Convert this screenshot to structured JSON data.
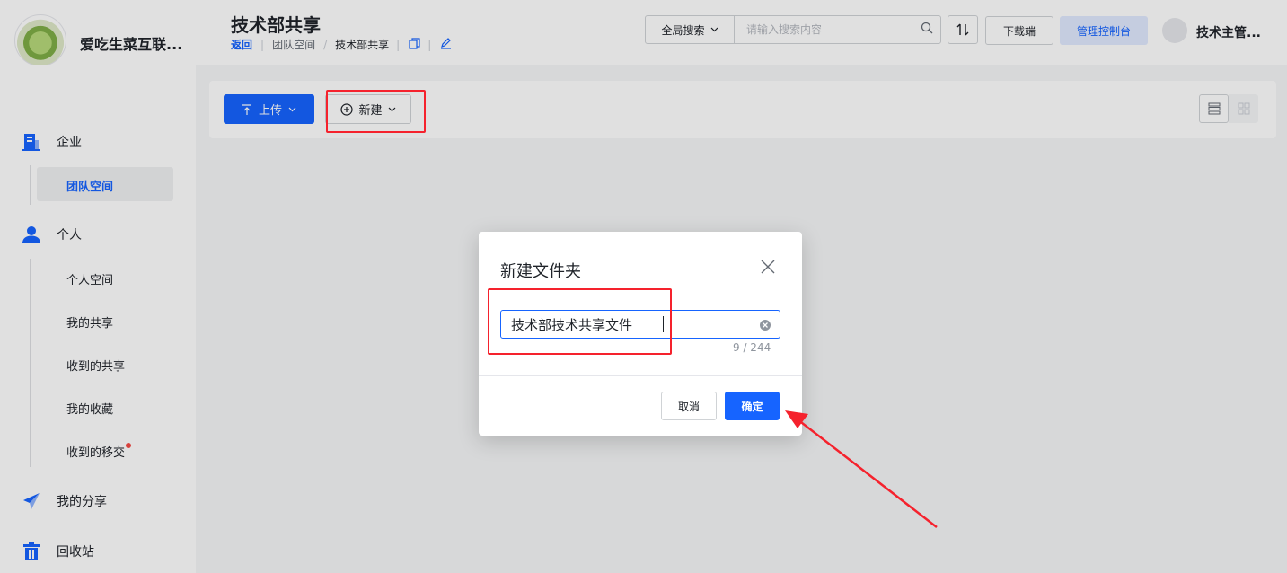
{
  "header": {
    "org_name": "爱吃生菜互联...",
    "page_title": "技术部共享",
    "breadcrumb": {
      "back": "返回",
      "team_space": "团队空间",
      "current": "技术部共享"
    },
    "search": {
      "scope": "全局搜索",
      "placeholder": "请输入搜索内容"
    },
    "download_label": "下载端",
    "admin_label": "管理控制台",
    "user_name": "技术主管..."
  },
  "sidebar": {
    "enterprise": "企业",
    "team_space": "团队空间",
    "personal": "个人",
    "personal_space": "个人空间",
    "my_shares": "我的共享",
    "received_shares": "收到的共享",
    "my_favorites": "我的收藏",
    "received_transfer": "收到的移交",
    "my_share_links": "我的分享",
    "recycle_bin": "回收站"
  },
  "toolbar": {
    "upload_label": "上传",
    "new_label": "新建"
  },
  "dialog": {
    "title": "新建文件夹",
    "input_value": "技术部技术共享文件",
    "counter": "9 / 244",
    "cancel_label": "取消",
    "ok_label": "确定"
  },
  "colors": {
    "primary": "#1664ff",
    "annotation_red": "#f5222d",
    "admin_bg": "#e1eaff"
  }
}
